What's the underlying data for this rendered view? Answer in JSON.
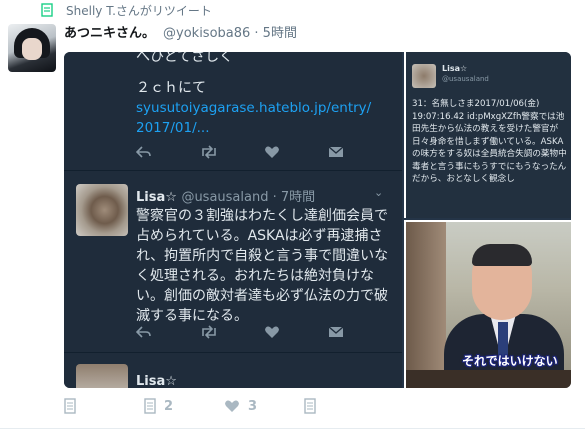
{
  "retweet_bar": {
    "text": "Shelly T.さんがリツイート",
    "icon": "retweet-icon"
  },
  "tweet": {
    "user_name": "あつニキさん。",
    "handle_time": "@yokisoba86 · 5時間"
  },
  "screenshot_left": {
    "top_fragment": "へひとてさしく",
    "line1": "２ｃｈにて",
    "link_line1": "syusutoiyagarase.hateblo.jp/entry/",
    "link_line2": "2017/01/...",
    "tweet2": {
      "name": "Lisa☆",
      "meta": "@usausaland · 7時間",
      "text": "警察官の３割強はわたくし達創価会員で占められている。ASKAは必ず再逮捕され、拘置所内で自殺と言う事で間違いなく処理される。おれたちは絶対負けない。創価の敵対者達も必ず仏法の力で破滅する事になる。"
    },
    "tweet3": {
      "name": "Lisa☆"
    }
  },
  "screenshot_right": {
    "name": "Lisa☆",
    "handle": "@usausaland",
    "text": "31：名無しさま2017/01/06(金) 19:07:16.42 id:pMxgXZfh警察では池田先生から仏法の教えを受けた警官が日々身命を惜しまず働いている。ASKAの味方をする奴は全員統合失調の薬物中毒者と言う事にもうすでにもうなったんだから、おとなしく観念し"
  },
  "photo": {
    "caption": "それではいけない"
  },
  "actions": {
    "reply_count": "",
    "retweet_count": "2",
    "like_count": "3"
  },
  "colors": {
    "link": "#1da1f2",
    "dark_bg": "#1f2c3b",
    "muted": "#657786"
  }
}
